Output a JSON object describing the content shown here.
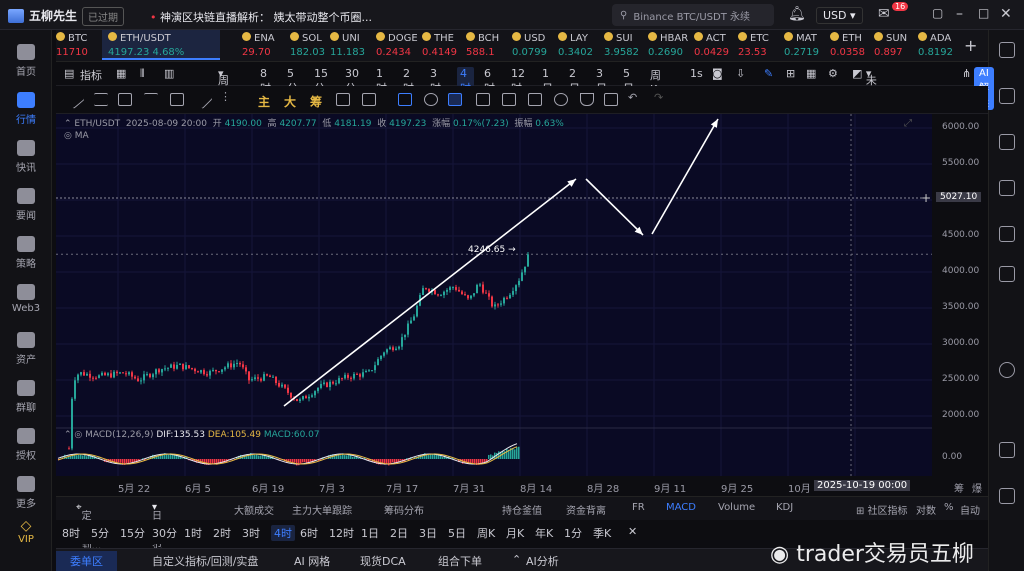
{
  "app": {
    "name": "五柳先生",
    "status_badge": "已过期",
    "news_ticker": "神演区块链直播解析：  姨太带动整个币圈..."
  },
  "search": {
    "placeholder": "Binance BTC/USDT 永续"
  },
  "header": {
    "currency": "USD",
    "notifications": "16"
  },
  "sidebar": {
    "items": [
      {
        "label": "首页"
      },
      {
        "label": "行情"
      },
      {
        "label": "快讯"
      },
      {
        "label": "要闻"
      },
      {
        "label": "策略"
      },
      {
        "label": "Web3"
      },
      {
        "label": "资产"
      },
      {
        "label": "群聊"
      },
      {
        "label": "授权"
      },
      {
        "label": "更多"
      },
      {
        "label": "VIP"
      }
    ]
  },
  "tickers": [
    {
      "name": "BTC",
      "price": "11710",
      "dir": "r"
    },
    {
      "name": "ETH/USDT",
      "price": "4197.23",
      "change": "4.68%",
      "dir": "g"
    },
    {
      "name": "ENA",
      "price": "29.70",
      "dir": "r"
    },
    {
      "name": "SOL",
      "price": "182.03",
      "dir": "g"
    },
    {
      "name": "UNI",
      "price": "11.183",
      "dir": "g"
    },
    {
      "name": "DOGE",
      "price": "0.2434",
      "dir": "r"
    },
    {
      "name": "THE",
      "price": "0.4149",
      "dir": "r"
    },
    {
      "name": "BCH",
      "price": "588.1",
      "dir": "r"
    },
    {
      "name": "USD",
      "price": "0.0799",
      "dir": "g"
    },
    {
      "name": "LAY",
      "price": "0.3402",
      "dir": "g"
    },
    {
      "name": "SUI",
      "price": "3.9582",
      "dir": "g"
    },
    {
      "name": "HBAR",
      "price": "0.2690",
      "dir": "g"
    },
    {
      "name": "ACT",
      "price": "0.0429",
      "dir": "r"
    },
    {
      "name": "ETC",
      "price": "23.53",
      "dir": "r"
    },
    {
      "name": "MAT",
      "price": "0.2719",
      "dir": "g"
    },
    {
      "name": "ETH",
      "price": "0.0358",
      "dir": "r"
    },
    {
      "name": "SUN",
      "price": "0.897",
      "dir": "r"
    },
    {
      "name": "ADA",
      "price": "0.8192",
      "dir": "g"
    }
  ],
  "toolbar1": {
    "indicators": "指标",
    "period": "周期",
    "timeframes": [
      "8时",
      "5分",
      "15分",
      "30分",
      "1时",
      "2时",
      "3时",
      "4时",
      "6时",
      "12时",
      "1日",
      "2日",
      "3日",
      "5日",
      "周K"
    ],
    "active_tf": "4时",
    "sec": "1s",
    "layout_name": "未命名",
    "ai": "AI解读"
  },
  "toolbar2": {
    "labels": [
      "主",
      "大",
      "筹"
    ]
  },
  "chart_info": {
    "symbol": "ETH/USDT",
    "date": "2025-08-09 20:00",
    "open_label": "开",
    "open": "4190.00",
    "high_label": "高",
    "high": "4207.77",
    "low_label": "低",
    "low": "4181.19",
    "close_label": "收",
    "close": "4197.23",
    "chg_label": "涨幅",
    "chg": "0.17%(7.23)",
    "amp_label": "振幅",
    "amp": "0.63%",
    "ma": "MA"
  },
  "macd": {
    "label": "MACD(12,26,9)",
    "dif": "DIF:135.53",
    "dea": "DEA:105.49",
    "macd": "MACD:60.07"
  },
  "price_axis": [
    "6000.00",
    "5500.00",
    "5027.10",
    "4500.00",
    "4000.00",
    "3500.00",
    "3000.00",
    "2500.00",
    "2000.00",
    "0.00"
  ],
  "cursor_price": "5027.10",
  "last_price_label": "4246.65",
  "x_axis": [
    "5月 22",
    "6月 5",
    "6月 19",
    "7月 3",
    "7月 17",
    "7月 31",
    "8月 14",
    "8月 28",
    "9月 11",
    "9月 25",
    "10月"
  ],
  "crosshair_date": "2025-10-19 00:00",
  "axis_ctrl": [
    "筹",
    "爆"
  ],
  "indicator_bar": {
    "locate": "定位到...",
    "range": "日期范围",
    "items": [
      "大额成交",
      "主力大单跟踪",
      "筹码分布",
      "持仓釜值",
      "资金背离",
      "FR",
      "MACD",
      "Volume",
      "KDJ"
    ],
    "active": "MACD",
    "right": [
      "社区指标",
      "对数",
      "%",
      "自动"
    ]
  },
  "tf_row": [
    "8时",
    "5分",
    "15分",
    "30分",
    "1时",
    "2时",
    "3时",
    "4时",
    "6时",
    "12时",
    "1日",
    "2日",
    "3日",
    "5日",
    "周K",
    "月K",
    "年K",
    "1分",
    "季K"
  ],
  "tf_row_active": "4时",
  "bottom_tabs": [
    "委单区",
    "自定义指标/回测/实盘",
    "AI 网格",
    "现货DCA",
    "组合下单",
    "AI分析"
  ],
  "watermark": "trader交易员五柳"
}
